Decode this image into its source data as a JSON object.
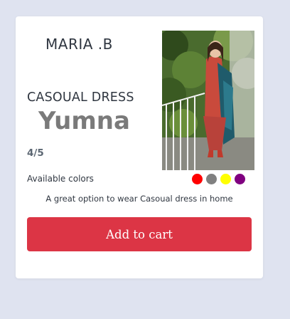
{
  "product": {
    "brand": "MARIA .B",
    "category": "CASOUAL DRESS",
    "name": "Yumna",
    "rating": "4/5",
    "colors_label": "Available colors",
    "colors": [
      {
        "name": "red",
        "hex": "#ff0000"
      },
      {
        "name": "gray",
        "hex": "#808080"
      },
      {
        "name": "yellow",
        "hex": "#ffff00"
      },
      {
        "name": "purple",
        "hex": "#800080"
      }
    ],
    "description": "A great option to wear Casoual dress in home",
    "add_to_cart_label": "Add to cart"
  },
  "colors": {
    "page_background": "#dfe3f0",
    "card_background": "#ffffff",
    "button": "#dc3545"
  }
}
